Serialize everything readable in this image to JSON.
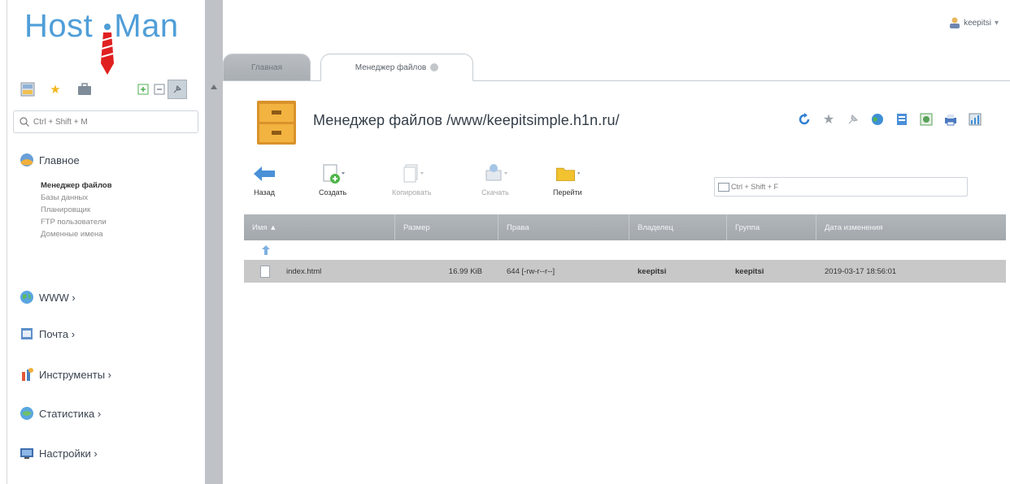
{
  "brand": {
    "logo_text": "Host  Man",
    "logo_left": "Host",
    "logo_right": "Man"
  },
  "user": {
    "name": "keepitsi",
    "icon": "user-icon"
  },
  "sidebar": {
    "toolbar_icons": [
      "tree-view-icon",
      "star-icon",
      "briefcase-icon",
      "expand-all-icon",
      "collapse-all-icon",
      "pin-icon"
    ],
    "search_placeholder": "Ctrl + Shift + M",
    "sections": [
      {
        "label": "Главное",
        "icon": "home-globe-icon"
      },
      {
        "label": "WWW ›",
        "icon": "www-globe-icon"
      },
      {
        "label": "Почта ›",
        "icon": "mail-icon"
      },
      {
        "label": "Инструменты ›",
        "icon": "tools-icon"
      },
      {
        "label": "Статистика ›",
        "icon": "stats-globe-icon"
      },
      {
        "label": "Настройки ›",
        "icon": "settings-monitor-icon"
      }
    ],
    "main_items": [
      {
        "label": "Менеджер файлов",
        "active": true
      },
      {
        "label": "Базы данных"
      },
      {
        "label": "Планировщик"
      },
      {
        "label": "FTP пользователи"
      },
      {
        "label": "Доменные имена"
      }
    ]
  },
  "tabs": [
    {
      "label": "Главная"
    },
    {
      "label": "Менеджер файлов"
    }
  ],
  "page": {
    "title": "Менеджер файлов /www/keepitsimple.h1n.ru/",
    "header_icons": [
      "refresh-icon",
      "star-icon",
      "pin-icon",
      "globe-icon",
      "document-icon",
      "help-icon",
      "print-icon",
      "chart-icon"
    ]
  },
  "toolbar": {
    "back": "Назад",
    "create": "Создать",
    "copy": "Копировать",
    "download": "Скачать",
    "goto": "Перейти",
    "filter_placeholder": "Ctrl + Shift + F"
  },
  "table": {
    "columns": [
      "Имя ▲",
      "Размер",
      "Права",
      "Владелец",
      "Группа",
      "Дата изменения"
    ],
    "rows": [
      {
        "name": "index.html",
        "size": "16.99 KiB",
        "perms": "644 [-rw-r--r--]",
        "owner": "keepitsi",
        "group": "keepitsi",
        "date": "2019-03-17 18:56:01"
      }
    ]
  },
  "colors": {
    "accent": "#4f9ed8",
    "logo_red": "#e02020",
    "header_gray": "#a7acb1",
    "row_selected": "#c8c8c8"
  }
}
